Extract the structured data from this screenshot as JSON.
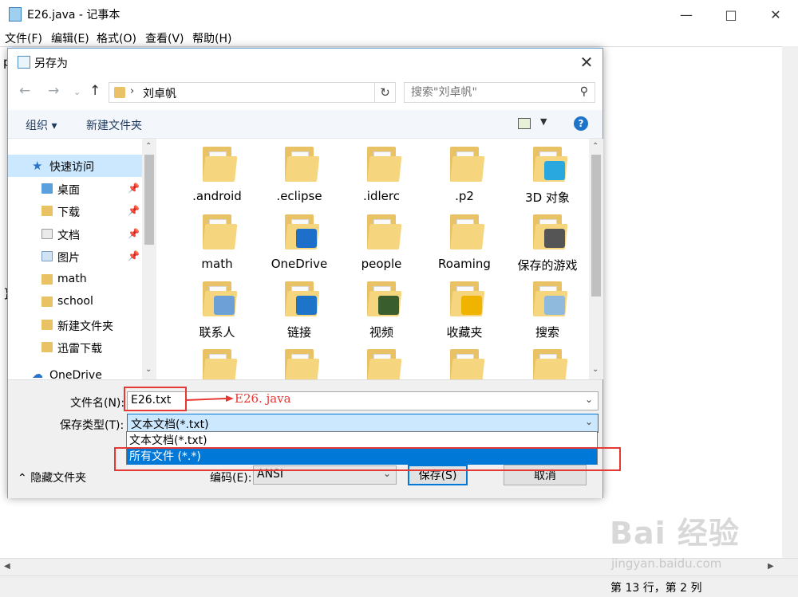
{
  "notepad": {
    "title": "E26.java - 记事本",
    "menu": [
      "文件(F)",
      "编辑(E)",
      "格式(O)",
      "查看(V)",
      "帮助(H)"
    ],
    "edit_fragments": [
      "p",
      "}"
    ],
    "status": "第 13 行，第 2 列"
  },
  "dialog": {
    "title": "另存为",
    "address_path": "刘卓帆",
    "search_placeholder": "搜索\"刘卓帆\"",
    "commands": {
      "organize": "组织 ▾",
      "new_folder": "新建文件夹"
    },
    "nav": {
      "quick_access": "快速访问",
      "items": [
        {
          "label": "桌面",
          "pinned": true
        },
        {
          "label": "下载",
          "pinned": true
        },
        {
          "label": "文档",
          "pinned": true
        },
        {
          "label": "图片",
          "pinned": true
        },
        {
          "label": "math",
          "pinned": false
        },
        {
          "label": "school",
          "pinned": false
        },
        {
          "label": "新建文件夹",
          "pinned": false
        },
        {
          "label": "迅雷下载",
          "pinned": false
        }
      ],
      "onedrive": "OneDrive"
    },
    "files": [
      {
        "label": ".android",
        "icon": "folder-icon"
      },
      {
        "label": ".eclipse",
        "icon": "folder-icon"
      },
      {
        "label": ".idlerc",
        "icon": "folder-icon"
      },
      {
        "label": ".p2",
        "icon": "folder-icon"
      },
      {
        "label": "3D 对象",
        "icon": "3d-objects-folder-icon"
      },
      {
        "label": "math",
        "icon": "folder-icon"
      },
      {
        "label": "OneDrive",
        "icon": "onedrive-folder-icon"
      },
      {
        "label": "people",
        "icon": "folder-icon"
      },
      {
        "label": "Roaming",
        "icon": "folder-icon"
      },
      {
        "label": "保存的游戏",
        "icon": "saved-games-folder-icon"
      },
      {
        "label": "联系人",
        "icon": "contacts-folder-icon"
      },
      {
        "label": "链接",
        "icon": "links-folder-icon"
      },
      {
        "label": "视频",
        "icon": "videos-folder-icon"
      },
      {
        "label": "收藏夹",
        "icon": "favorites-folder-icon"
      },
      {
        "label": "搜索",
        "icon": "searches-folder-icon"
      }
    ],
    "filename_label": "文件名(N):",
    "filename_value": "E26.txt",
    "type_label": "保存类型(T):",
    "type_value": "文本文档(*.txt)",
    "type_options": [
      "文本文档(*.txt)",
      "所有文件 (*.*)"
    ],
    "type_selected_index": 1,
    "hide_folders": "隐藏文件夹",
    "encoding_label": "编码(E):",
    "encoding_value": "ANSI",
    "save_button": "保存(S)",
    "cancel_button": "取消"
  },
  "annotation": {
    "text": "E26. java",
    "color": "#e53935"
  },
  "watermark": {
    "brand": "Bai 经验",
    "url": "jingyan.baidu.com"
  },
  "colors": {
    "selection": "#0078d7",
    "nav_active": "#cce8ff",
    "folder": "#e8c264"
  }
}
